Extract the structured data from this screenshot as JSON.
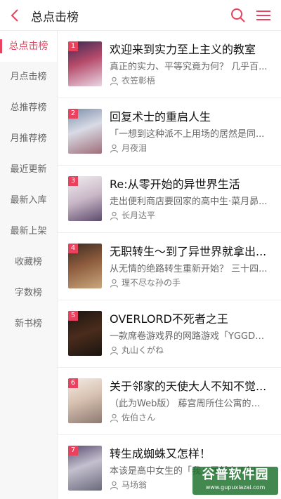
{
  "header": {
    "title": "总点击榜"
  },
  "sidebar": {
    "items": [
      {
        "label": "总点击榜"
      },
      {
        "label": "月点击榜"
      },
      {
        "label": "总推荐榜"
      },
      {
        "label": "月推荐榜"
      },
      {
        "label": "最近更新"
      },
      {
        "label": "最新入库"
      },
      {
        "label": "最新上架"
      },
      {
        "label": "收藏榜"
      },
      {
        "label": "字数榜"
      },
      {
        "label": "新书榜"
      }
    ],
    "active_index": 0
  },
  "books": [
    {
      "rank": "1",
      "title": "欢迎来到实力至上主义的教室",
      "desc": "真正的实力、平等究竟为何？ 几乎百...",
      "author": "衣笠彰梧"
    },
    {
      "rank": "2",
      "title": "回复术士的重启人生",
      "desc": "「一想到这种派不上用场的居然是同...",
      "author": "月夜泪"
    },
    {
      "rank": "3",
      "title": "Re:从零开始的异世界生活",
      "desc": "走出便利商店要回家的高中生·菜月昴...",
      "author": "长月达平"
    },
    {
      "rank": "4",
      "title": "无职转生～到了异世界就拿出...",
      "desc": "从无情的绝路转生重新开始？ 三十四...",
      "author": "理不尽な孙の手"
    },
    {
      "rank": "5",
      "title": "OVERLORD不死者之王",
      "desc": "一款席卷游戏界的网路游戏「YGGDR...",
      "author": "丸山くがね"
    },
    {
      "rank": "6",
      "title": "关于邻家的天使大人不知不觉...",
      "desc": "（此为Web版） 藤宫周所住公寓的隔...",
      "author": "佐伯さん"
    },
    {
      "rank": "7",
      "title": "转生成蜘蛛又怎样！",
      "desc": "本该是高中女生的「我」居然在不知...",
      "author": "马场翁"
    }
  ],
  "icons": {
    "back": "chevron-left-icon",
    "search": "search-icon",
    "menu": "hamburger-menu-icon",
    "author": "person-icon"
  },
  "colors": {
    "accent": "#e8425f",
    "rank_badge": "#e8425f",
    "sidebar_bg": "#f7f7f7"
  },
  "watermark": {
    "title": "谷普软件园",
    "url": "www.gupuxiazai.com"
  }
}
